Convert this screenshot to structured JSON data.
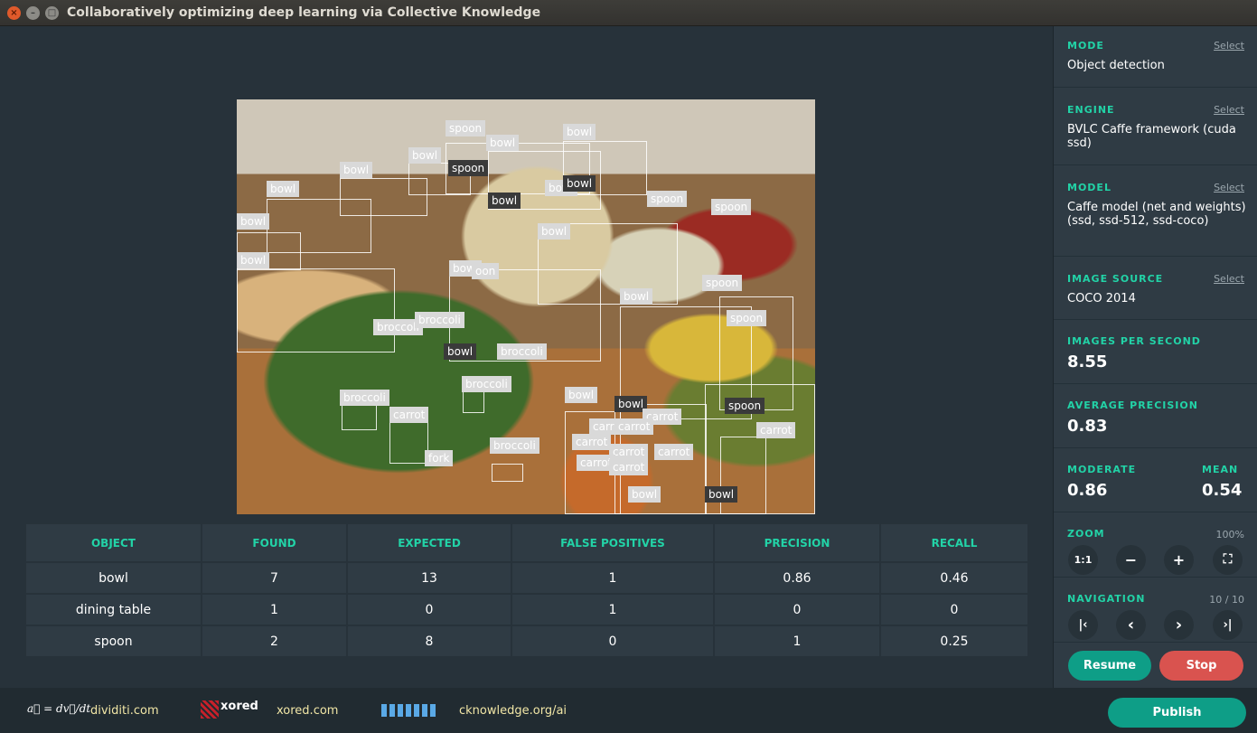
{
  "window": {
    "title": "Collaboratively optimizing deep learning via Collective Knowledge",
    "close_glyph": "×",
    "min_glyph": "–",
    "max_glyph": "□"
  },
  "detections": [
    {
      "label": "bowl"
    },
    {
      "label": "bowl"
    },
    {
      "label": "bowl"
    },
    {
      "label": "bowl"
    },
    {
      "label": "bowl"
    },
    {
      "label": "spoon"
    },
    {
      "label": "spoon"
    },
    {
      "label": "bowl"
    },
    {
      "label": "bowl"
    },
    {
      "label": "bowl"
    },
    {
      "label": "bowl"
    },
    {
      "label": "bowl"
    },
    {
      "label": "spoon"
    },
    {
      "label": "spoon"
    },
    {
      "label": "bowl"
    },
    {
      "label": "bowl"
    },
    {
      "label": "oon"
    },
    {
      "label": "spoon"
    },
    {
      "label": "broccoli"
    },
    {
      "label": "broccoli"
    },
    {
      "label": "bowl"
    },
    {
      "label": "spoon"
    },
    {
      "label": "broccoli"
    },
    {
      "label": "broccoli"
    },
    {
      "label": "bowl"
    },
    {
      "label": "broccoli"
    },
    {
      "label": "carrot"
    },
    {
      "label": "bowl"
    },
    {
      "label": "bowl"
    },
    {
      "label": "spoon"
    },
    {
      "label": "carrot"
    },
    {
      "label": "carrot"
    },
    {
      "label": "carrot"
    },
    {
      "label": "carrot"
    },
    {
      "label": "broccoli"
    },
    {
      "label": "carrot"
    },
    {
      "label": "fork"
    },
    {
      "label": "carrot"
    },
    {
      "label": "carrot"
    },
    {
      "label": "carrot"
    },
    {
      "label": "carrot"
    },
    {
      "label": "bowl"
    },
    {
      "label": "bowl"
    }
  ],
  "results": {
    "headers": [
      "OBJECT",
      "FOUND",
      "EXPECTED",
      "FALSE POSITIVES",
      "PRECISION",
      "RECALL"
    ],
    "rows": [
      [
        "bowl",
        "7",
        "13",
        "1",
        "0.86",
        "0.46"
      ],
      [
        "dining table",
        "1",
        "0",
        "1",
        "0",
        "0"
      ],
      [
        "spoon",
        "2",
        "8",
        "0",
        "1",
        "0.25"
      ]
    ]
  },
  "sidebar": {
    "mode": {
      "label": "MODE",
      "link": "Select",
      "value": "Object detection"
    },
    "engine": {
      "label": "ENGINE",
      "link": "Select",
      "value": "BVLC Caffe framework (cuda ssd)"
    },
    "model": {
      "label": "MODEL",
      "link": "Select",
      "value": "Caffe model (net and weights) (ssd, ssd-512, ssd-coco)"
    },
    "image_source": {
      "label": "IMAGE SOURCE",
      "link": "Select",
      "value": "COCO 2014"
    },
    "ips": {
      "label": "IMAGES PER SECOND",
      "value": "8.55"
    },
    "avg_precision": {
      "label": "AVERAGE PRECISION",
      "value": "0.83"
    },
    "moderate": {
      "label": "MODERATE",
      "value": "0.86"
    },
    "mean": {
      "label": "MEAN",
      "value": "0.54"
    },
    "zoom": {
      "label": "ZOOM",
      "value": "100%",
      "btn_fit": "1:1",
      "btn_out": "−",
      "btn_in": "+",
      "btn_full": "⛶"
    },
    "navigation": {
      "label": "NAVIGATION",
      "value": "10 / 10",
      "btn_first": "|‹",
      "btn_prev": "‹",
      "btn_next": "›",
      "btn_last": "›|"
    },
    "resume": "Resume",
    "stop": "Stop"
  },
  "footer": {
    "formula": "a⃗ = dv⃗/dt",
    "dividiti": "dividiti.com",
    "xored_logo": "xored",
    "xored": "xored.com",
    "ck": "cknowledge.org/ai",
    "publish": "Publish"
  },
  "colors": {
    "accent": "#22d3a7",
    "resume_bg": "#0e9e87",
    "stop_bg": "#d9534f",
    "panel_bg": "#2f3b44",
    "main_bg": "#27323a"
  }
}
